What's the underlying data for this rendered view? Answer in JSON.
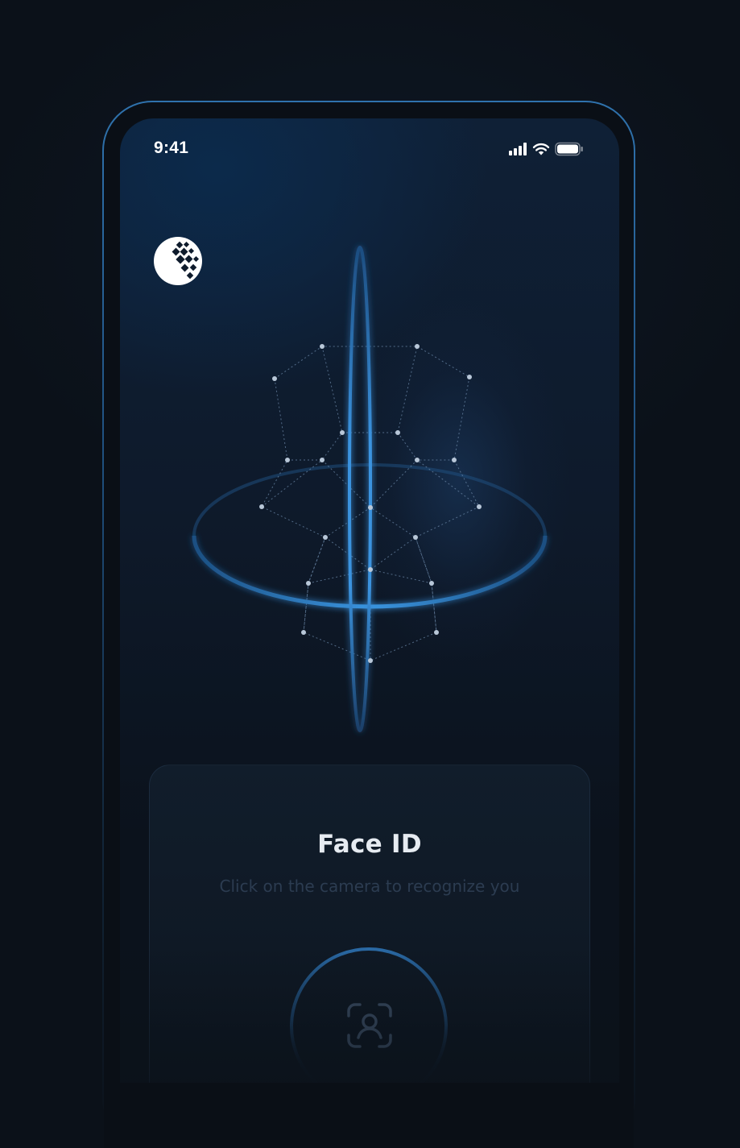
{
  "status_bar": {
    "time": "9:41",
    "icons": [
      "cellular-signal-icon",
      "wifi-icon",
      "battery-icon"
    ]
  },
  "app": {
    "logo_icon": "webmoney-globe-icon"
  },
  "face_card": {
    "title": "Face ID",
    "subtitle": "Click on the camera to recognize you",
    "camera_icon": "face-id-icon"
  },
  "colors": {
    "background": "#0b1119",
    "accent_blue": "#3b8fdc",
    "title_text": "#e6ebf1",
    "subtitle_text": "#2c3c51"
  }
}
